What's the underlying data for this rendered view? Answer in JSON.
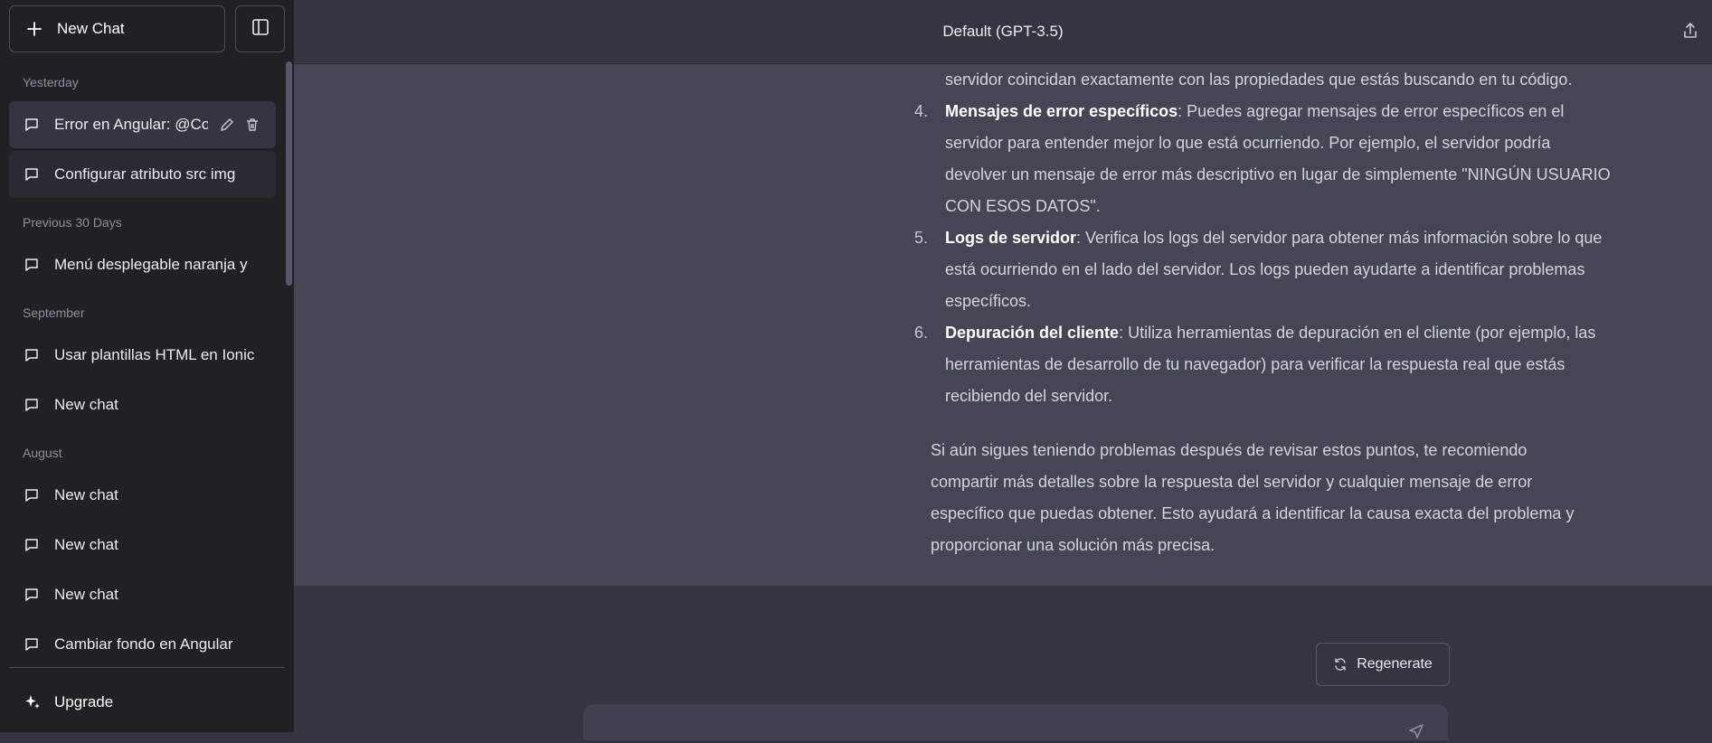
{
  "sidebar": {
    "new_chat_label": "New Chat",
    "groups": {
      "yesterday": "Yesterday",
      "previous30": "Previous 30 Days",
      "september": "September",
      "august": "August"
    },
    "items": [
      {
        "label": "Error en Angular: @Co"
      },
      {
        "label": "Configurar atributo src img"
      },
      {
        "label": "Menú desplegable naranja y"
      },
      {
        "label": "Usar plantillas HTML en Ionic"
      },
      {
        "label": "New chat"
      },
      {
        "label": "New chat"
      },
      {
        "label": "New chat"
      },
      {
        "label": "New chat"
      },
      {
        "label": "Cambiar fondo en Angular"
      }
    ],
    "upgrade_label": "Upgrade"
  },
  "header": {
    "model": "Default (GPT-3.5)"
  },
  "message": {
    "top_line": "servidor coincidan exactamente con las propiedades que estás buscando en tu código.",
    "list": [
      {
        "num": "4.",
        "title": "Mensajes de error específicos",
        "lines": [
          ": Puedes agregar mensajes de error específicos en el",
          "servidor para entender mejor lo que está ocurriendo. Por ejemplo, el servidor podría",
          "devolver un mensaje de error más descriptivo en lugar de simplemente \"NINGÚN USUARIO",
          "CON ESOS DATOS\"."
        ]
      },
      {
        "num": "5.",
        "title": "Logs de servidor",
        "lines": [
          ": Verifica los logs del servidor para obtener más información sobre lo que",
          "está ocurriendo en el lado del servidor. Los logs pueden ayudarte a identificar problemas",
          "específicos."
        ]
      },
      {
        "num": "6.",
        "title": "Depuración del cliente",
        "lines": [
          ": Utiliza herramientas de depuración en el cliente (por ejemplo, las",
          "herramientas de desarrollo de tu navegador) para verificar la respuesta real que estás",
          "recibiendo del servidor."
        ]
      }
    ],
    "closing": [
      "Si aún sigues teniendo problemas después de revisar estos puntos, te recomiendo",
      "compartir más detalles sobre la respuesta del servidor y cualquier mensaje de error",
      "específico que puedas obtener. Esto ayudará a identificar la causa exacta del problema y",
      "proporcionar una solución más precisa."
    ]
  },
  "regenerate_label": "Regenerate",
  "composer": {
    "value": ""
  },
  "colors": {
    "sidebar_bg": "#202123",
    "main_bg": "#343541",
    "message_bg": "#444654"
  }
}
